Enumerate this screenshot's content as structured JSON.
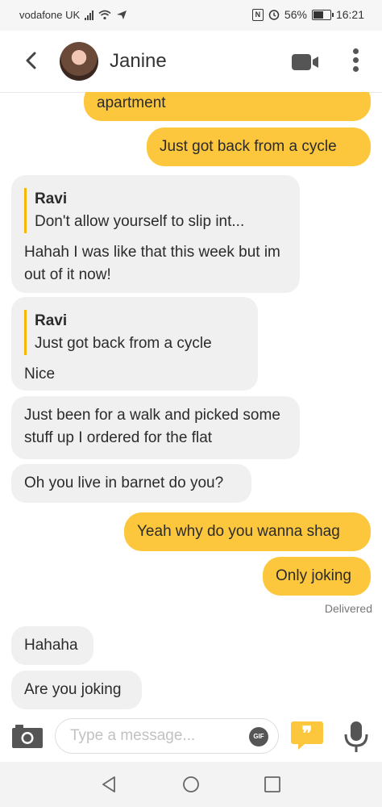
{
  "status_bar": {
    "carrier": "vodafone UK",
    "battery": "56%",
    "battery_level": 0.56,
    "time": "16:21"
  },
  "header": {
    "contact_name": "Janine"
  },
  "messages": [
    {
      "dir": "out",
      "text": "apartment"
    },
    {
      "dir": "out",
      "text": "Just got back from a cycle"
    },
    {
      "dir": "in",
      "quote_author": "Ravi",
      "quote_text": "Don't allow yourself to slip int...",
      "text": "Hahah I was like that this week but im out of it now!"
    },
    {
      "dir": "in",
      "quote_author": "Ravi",
      "quote_text": "Just got back from a cycle",
      "text": "Nice"
    },
    {
      "dir": "in",
      "text": "Just been for a walk and picked some stuff up I ordered for the flat"
    },
    {
      "dir": "in",
      "text": "Oh you live in barnet do you?"
    },
    {
      "dir": "out",
      "text": "Yeah why do you wanna shag"
    },
    {
      "dir": "out",
      "text": "Only joking"
    },
    {
      "dir": "in",
      "text": "Hahaha"
    },
    {
      "dir": "in",
      "text": "Are you joking"
    }
  ],
  "delivered_label": "Delivered",
  "composer": {
    "placeholder": "Type a message...",
    "gif_label": "GIF"
  },
  "colors": {
    "accent": "#fcc73d",
    "incoming_bubble": "#f0f0f0",
    "quote_bar": "#f5b70a"
  }
}
